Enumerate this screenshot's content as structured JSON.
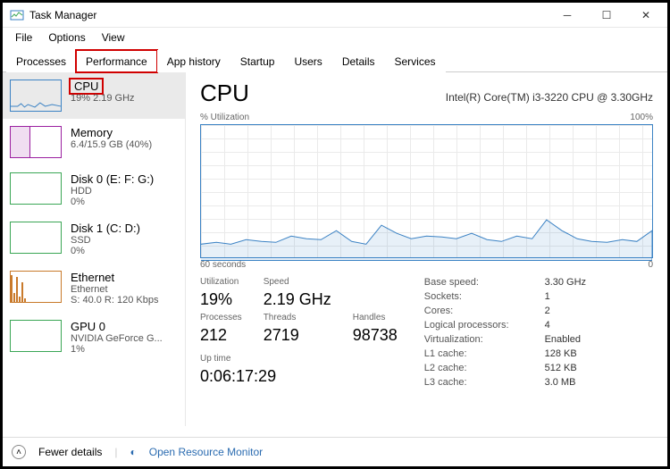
{
  "window": {
    "title": "Task Manager"
  },
  "menu": {
    "file": "File",
    "options": "Options",
    "view": "View"
  },
  "tabs": {
    "processes": "Processes",
    "performance": "Performance",
    "app_history": "App history",
    "startup": "Startup",
    "users": "Users",
    "details": "Details",
    "services": "Services"
  },
  "sidebar": [
    {
      "title": "CPU",
      "line2": "19% 2.19 GHz",
      "line3": ""
    },
    {
      "title": "Memory",
      "line2": "6.4/15.9 GB (40%)",
      "line3": ""
    },
    {
      "title": "Disk 0 (E: F: G:)",
      "line2": "HDD",
      "line3": "0%"
    },
    {
      "title": "Disk 1 (C: D:)",
      "line2": "SSD",
      "line3": "0%"
    },
    {
      "title": "Ethernet",
      "line2": "Ethernet",
      "line3": "S: 40.0 R: 120 Kbps"
    },
    {
      "title": "GPU 0",
      "line2": "NVIDIA GeForce G...",
      "line3": "1%"
    }
  ],
  "main": {
    "title": "CPU",
    "subtitle": "Intel(R) Core(TM) i3-3220 CPU @ 3.30GHz",
    "chart_top_left": "% Utilization",
    "chart_top_right": "100%",
    "chart_bottom_left": "60 seconds",
    "chart_bottom_right": "0",
    "stats": {
      "utilization_lbl": "Utilization",
      "utilization": "19%",
      "speed_lbl": "Speed",
      "speed": "2.19 GHz",
      "processes_lbl": "Processes",
      "processes": "212",
      "threads_lbl": "Threads",
      "threads": "2719",
      "handles_lbl": "Handles",
      "handles": "98738",
      "uptime_lbl": "Up time",
      "uptime": "0:06:17:29"
    },
    "right": {
      "base_speed_k": "Base speed:",
      "base_speed_v": "3.30 GHz",
      "sockets_k": "Sockets:",
      "sockets_v": "1",
      "cores_k": "Cores:",
      "cores_v": "2",
      "lprocs_k": "Logical processors:",
      "lprocs_v": "4",
      "virt_k": "Virtualization:",
      "virt_v": "Enabled",
      "l1_k": "L1 cache:",
      "l1_v": "128 KB",
      "l2_k": "L2 cache:",
      "l2_v": "512 KB",
      "l3_k": "L3 cache:",
      "l3_v": "3.0 MB"
    }
  },
  "footer": {
    "fewer": "Fewer details",
    "resmon": "Open Resource Monitor"
  },
  "chart_data": {
    "type": "line",
    "title": "% Utilization",
    "ylabel": "% Utilization",
    "xlabel": "seconds",
    "ylim": [
      0,
      100
    ],
    "xlim": [
      60,
      0
    ],
    "x": [
      60,
      58,
      56,
      54,
      52,
      50,
      48,
      46,
      44,
      42,
      40,
      38,
      36,
      34,
      32,
      30,
      28,
      26,
      24,
      22,
      20,
      18,
      16,
      14,
      12,
      10,
      8,
      6,
      4,
      2,
      0
    ],
    "values": [
      12,
      13,
      12,
      15,
      14,
      13,
      18,
      16,
      15,
      22,
      14,
      12,
      26,
      20,
      16,
      18,
      17,
      16,
      20,
      15,
      14,
      18,
      16,
      30,
      22,
      16,
      14,
      13,
      15,
      14,
      22
    ]
  }
}
